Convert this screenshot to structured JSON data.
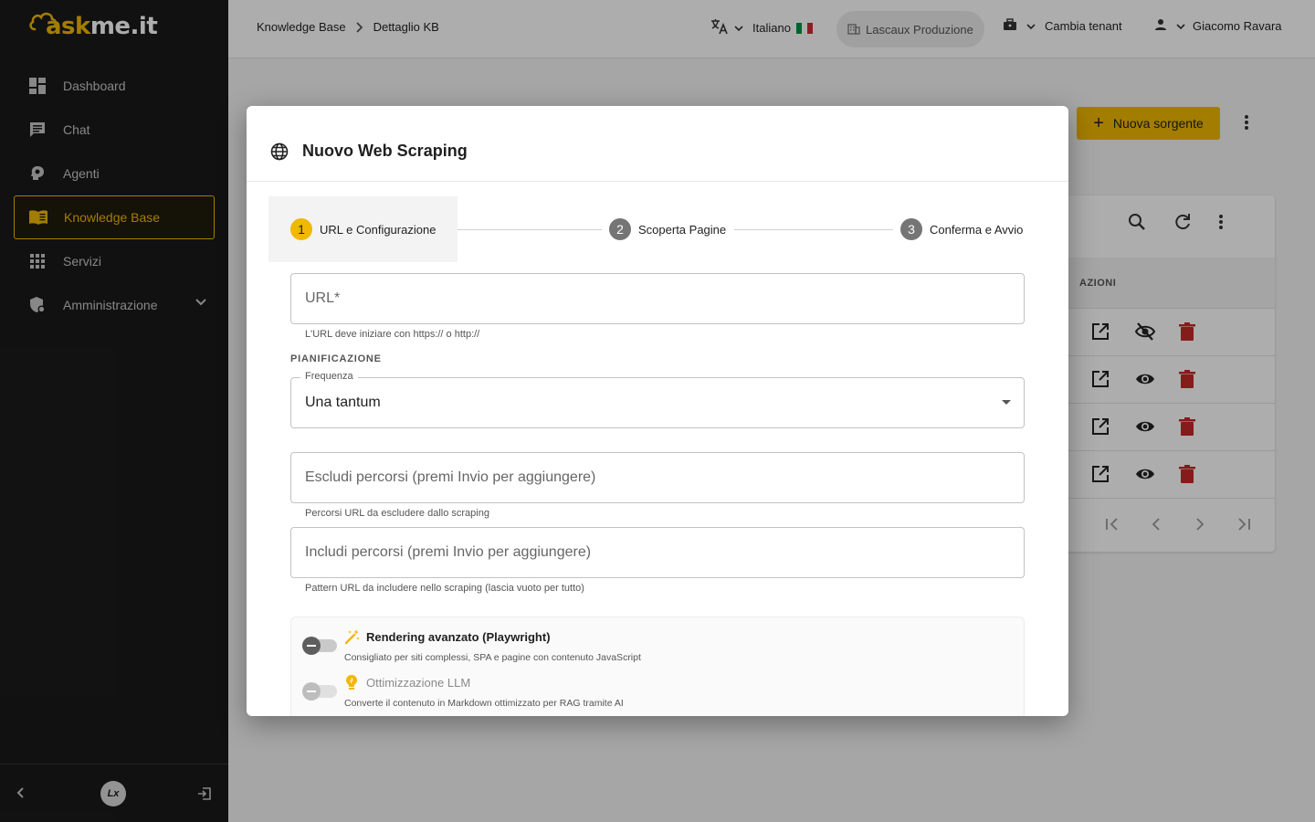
{
  "app": {
    "logo_prefix": "ask",
    "logo_suffix": "me.it"
  },
  "sidebar": {
    "items": [
      {
        "label": "Dashboard",
        "icon": "dashboard-icon"
      },
      {
        "label": "Chat",
        "icon": "chat-icon"
      },
      {
        "label": "Agenti",
        "icon": "agent-icon"
      },
      {
        "label": "Knowledge Base",
        "icon": "book-icon",
        "active": true
      },
      {
        "label": "Servizi",
        "icon": "grid-icon"
      },
      {
        "label": "Amministrazione",
        "icon": "admin-shield-icon",
        "expandable": true
      }
    ],
    "footer_badge": "Lx"
  },
  "header": {
    "breadcrumb": [
      "Knowledge Base",
      "Dettaglio KB"
    ],
    "language": "Italiano",
    "tenant": "Lascaux Produzione",
    "change_tenant": "Cambia tenant",
    "user": "Giacomo Ravara"
  },
  "page": {
    "new_source_button": "Nuova sorgente",
    "table_actions_header": "AZIONI"
  },
  "modal": {
    "title": "Nuovo Web Scraping",
    "steps": [
      {
        "number": "1",
        "label": "URL e Configurazione",
        "active": true
      },
      {
        "number": "2",
        "label": "Scoperta Pagine"
      },
      {
        "number": "3",
        "label": "Conferma e Avvio"
      }
    ],
    "url_field": {
      "placeholder": "URL*",
      "value": "",
      "hint": "L'URL deve iniziare con https:// o http://"
    },
    "schedule_section": "PIANIFICAZIONE",
    "frequency": {
      "label": "Frequenza",
      "value": "Una tantum"
    },
    "exclude_field": {
      "placeholder": "Escludi percorsi (premi Invio per aggiungere)",
      "hint": "Percorsi URL da escludere dallo scraping"
    },
    "include_field": {
      "placeholder": "Includi percorsi (premi Invio per aggiungere)",
      "hint": "Pattern URL da includere nello scraping (lascia vuoto per tutto)"
    },
    "options": [
      {
        "title": "Rendering avanzato (Playwright)",
        "description": "Consigliato per siti complessi, SPA e pagine con contenuto JavaScript",
        "enabled": false,
        "disabled": false
      },
      {
        "title": "Ottimizzazione LLM",
        "description": "Converte il contenuto in Markdown ottimizzato per RAG tramite AI",
        "enabled": false,
        "disabled": true
      }
    ]
  },
  "colors": {
    "accent": "#f1b800",
    "sidebar_bg": "#1a1a1a",
    "danger": "#c62828"
  }
}
